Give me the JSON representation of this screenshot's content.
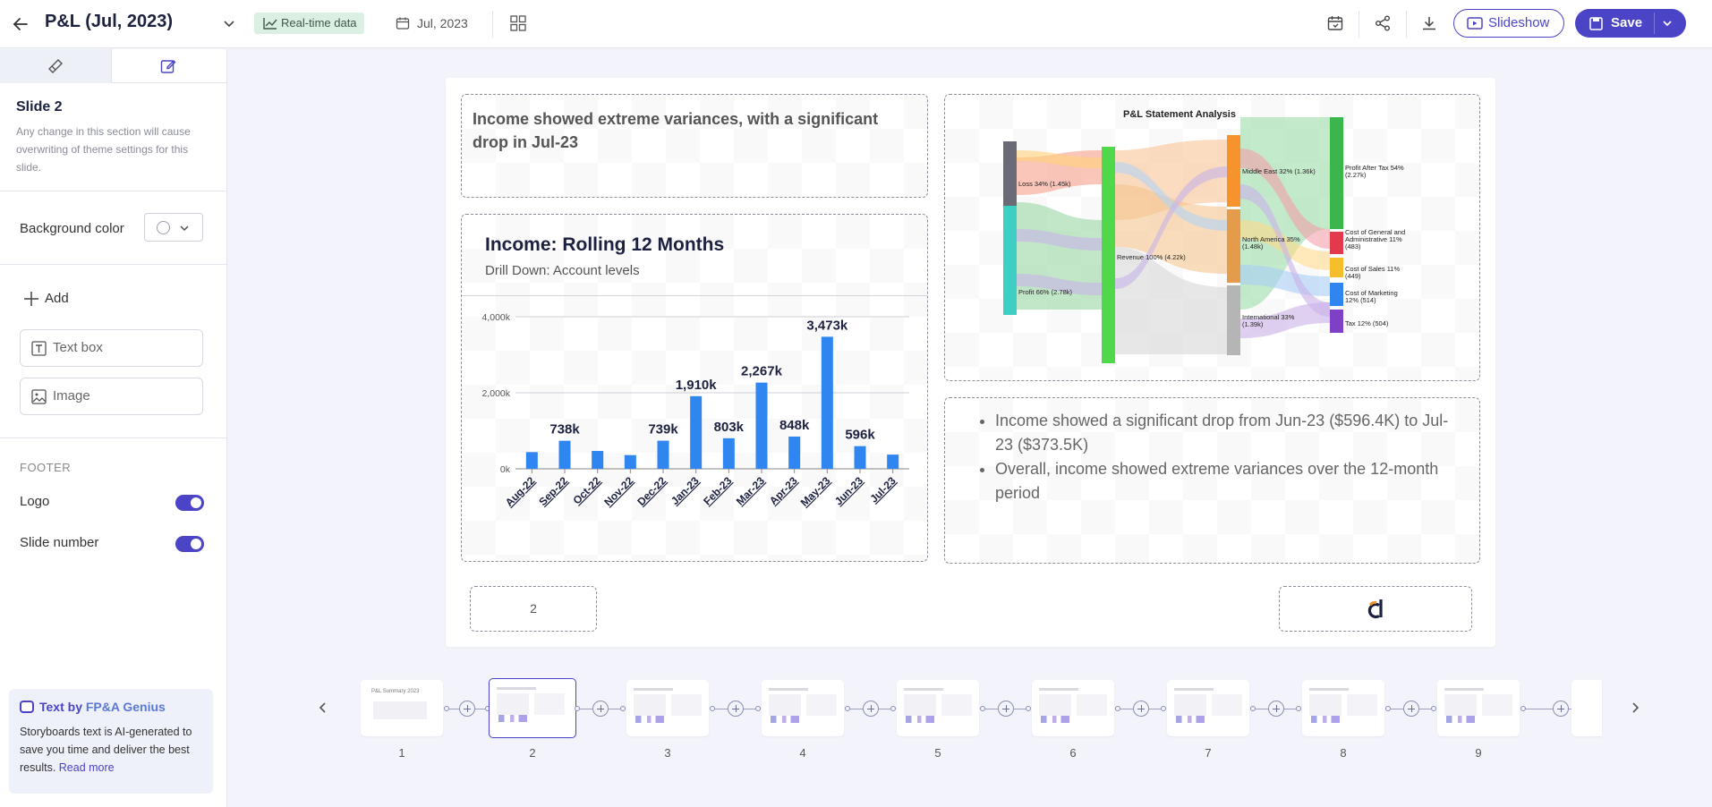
{
  "header": {
    "title": "P&L (Jul, 2023)",
    "realtime_label": "Real-time data",
    "date_label": "Jul, 2023",
    "slideshow_label": "Slideshow",
    "save_label": "Save"
  },
  "sidebar": {
    "slide_heading": "Slide 2",
    "slide_note": "Any change in this section will cause overwriting of theme settings for this slide.",
    "background_label": "Background color",
    "add_label": "Add",
    "add_items": [
      "Text box",
      "Image"
    ],
    "footer_label": "FOOTER",
    "toggles": [
      {
        "label": "Logo",
        "on": true
      },
      {
        "label": "Slide number",
        "on": true
      }
    ],
    "genius": {
      "title_prefix": "Text by ",
      "title_brand": "FP&A Genius",
      "text": "Storyboards text is AI-generated to save you time and deliver the best results.",
      "link": "Read more"
    }
  },
  "slide": {
    "headline": "Income showed extreme variances, with a significant drop in Jul-23",
    "chart_title": "Income: Rolling 12 Months",
    "chart_subtitle": "Drill Down: Account levels",
    "bullets": [
      "Income showed a significant drop from Jun-23 ($596.4K) to Jul-23 ($373.5K)",
      "Overall, income showed extreme variances over the 12-month period"
    ],
    "slide_number": "2",
    "sankey": {
      "title": "P&L Statement Analysis",
      "nodes": [
        "Loss 34% (1.45k)",
        "Profit 66% (2.78k)",
        "Revenue 100% (4.22k)",
        "Middle East 32% (1.36k)",
        "North America 35% (1.48k)",
        "International 33% (1.39k)",
        "Profit After Tax 54% (2.27k)",
        "Cost of General and Administrative 11% (483)",
        "Cost of Sales 11% (449)",
        "Cost of Marketing 12% (514)",
        "Tax 12% (504)"
      ],
      "colors": [
        "#6b6b78",
        "#3ecfc4",
        "#4fd84a",
        "#f7932c",
        "#e59c4a",
        "#b5b5b5",
        "#3ab64c",
        "#e23a4c",
        "#f6be2c",
        "#2f86f0",
        "#7f3fc6"
      ]
    }
  },
  "chart_data": {
    "type": "bar",
    "categories": [
      "Aug-22",
      "Sep-22",
      "Oct-22",
      "Nov-22",
      "Dec-22",
      "Jan-23",
      "Feb-23",
      "Mar-23",
      "Apr-23",
      "May-23",
      "Jun-23",
      "Jul-23"
    ],
    "values": [
      440,
      738,
      470,
      360,
      739,
      1910,
      803,
      2267,
      848,
      3473,
      596,
      373
    ],
    "data_labels": [
      "",
      "738k",
      "",
      "",
      "739k",
      "1,910k",
      "803k",
      "2,267k",
      "848k",
      "3,473k",
      "596k",
      ""
    ],
    "yticks": [
      "4,000k",
      "2,000k",
      "0k"
    ],
    "ylim": [
      0,
      4000
    ],
    "bar_color": "#2f86f0"
  },
  "filmstrip": {
    "slides": [
      "1",
      "2",
      "3",
      "4",
      "5",
      "6",
      "7",
      "8",
      "9"
    ],
    "first_thumb_title": "P&L Summary 2023",
    "active": "2"
  }
}
